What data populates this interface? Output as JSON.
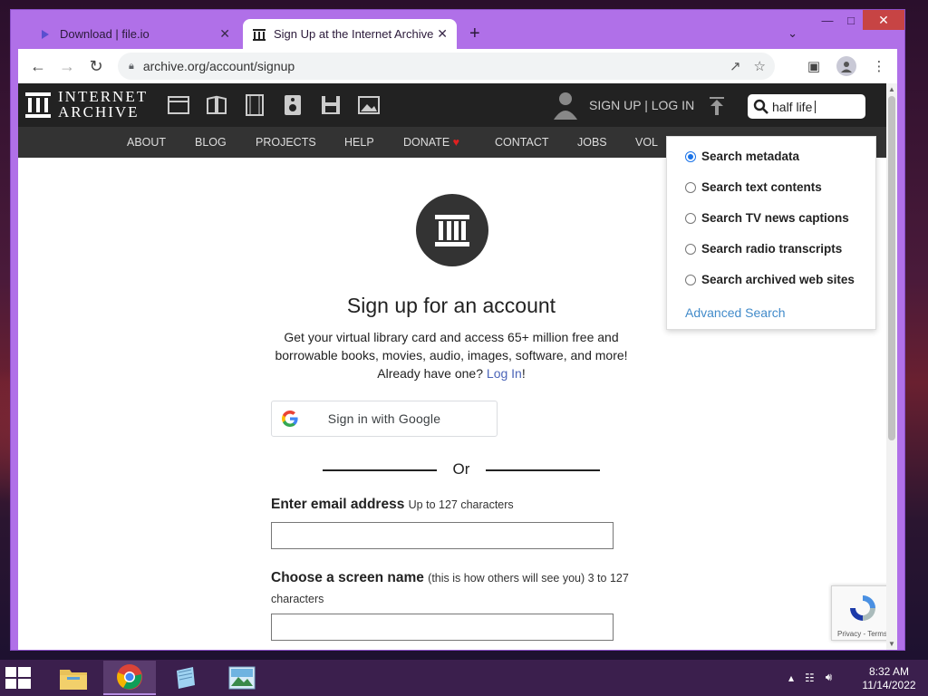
{
  "browser": {
    "tabs": [
      {
        "title": "Download | file.io"
      },
      {
        "title": "Sign Up at the Internet Archive"
      }
    ],
    "url": "archive.org/account/signup"
  },
  "ia": {
    "logo_line1": "INTERNET",
    "logo_line2": "ARCHIVE",
    "signup_login": "SIGN UP | LOG IN",
    "search_value": "half life",
    "nav": [
      "ABOUT",
      "BLOG",
      "PROJECTS",
      "HELP",
      "DONATE",
      "CONTACT",
      "JOBS",
      "VOL"
    ],
    "search_options": [
      {
        "label": "Search metadata",
        "selected": true
      },
      {
        "label": "Search text contents",
        "selected": false
      },
      {
        "label": "Search TV news captions",
        "selected": false
      },
      {
        "label": "Search radio transcripts",
        "selected": false
      },
      {
        "label": "Search archived web sites",
        "selected": false
      }
    ],
    "advanced_search": "Advanced Search"
  },
  "signup": {
    "title": "Sign up for an account",
    "desc_line1": "Get your virtual library card and access 65+ million free and",
    "desc_line2": "borrowable books, movies, audio, images, software, and more!",
    "desc_line3_pre": "Already have one?",
    "login_link": "Log In",
    "desc_line3_post": "!",
    "google_btn": "Sign in with Google",
    "or": "Or",
    "email_label": "Enter email address",
    "email_note": "Up to 127 characters",
    "screen_name_label": "Choose a screen name",
    "screen_name_note": "(this is how others will see you) 3 to 127",
    "screen_name_note2": "characters"
  },
  "recaptcha": {
    "text": "Privacy - Terms"
  },
  "taskbar": {
    "time": "8:32 AM",
    "date": "11/14/2022"
  },
  "colors": {
    "accent": "#1a73e8",
    "link": "#428bca",
    "window_frame": "#b070e8"
  }
}
